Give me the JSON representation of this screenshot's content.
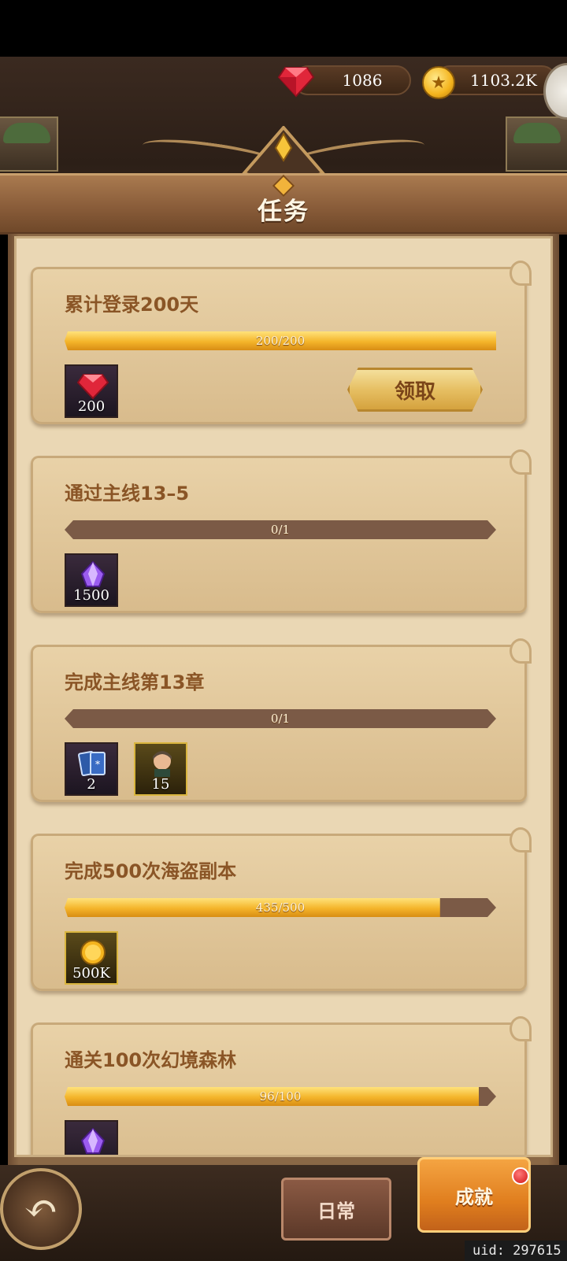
{
  "resources": {
    "gems": "1086",
    "coins": "1103.2K"
  },
  "header": {
    "title": "任务"
  },
  "quests": [
    {
      "title": "累计登录200天",
      "progress_text": "200/200",
      "progress": 1.0,
      "rewards": [
        {
          "icon": "ruby-gem-icon",
          "qty": "200"
        }
      ],
      "claim_label": "领取"
    },
    {
      "title": "通过主线13–5",
      "progress_text": "0/1",
      "progress": 0.0,
      "rewards": [
        {
          "icon": "purple-crystal-icon",
          "qty": "1500"
        }
      ]
    },
    {
      "title": "完成主线第13章",
      "progress_text": "0/1",
      "progress": 0.0,
      "rewards": [
        {
          "icon": "card-pack-icon",
          "qty": "2"
        },
        {
          "icon": "hero-portrait-icon",
          "qty": "15"
        }
      ]
    },
    {
      "title": "完成500次海盗副本",
      "progress_text": "435/500",
      "progress": 0.87,
      "rewards": [
        {
          "icon": "gold-coin-icon",
          "qty": "500K"
        }
      ]
    },
    {
      "title": "通关100次幻境森林",
      "progress_text": "96/100",
      "progress": 0.96,
      "rewards": [
        {
          "icon": "purple-crystal-icon",
          "qty": ""
        }
      ]
    }
  ],
  "tabs": {
    "daily": "日常",
    "achievement": "成就"
  },
  "footer": {
    "uid": "uid: 297615"
  },
  "colors": {
    "accent": "#f4b42a",
    "panel": "#ead7b4",
    "title_text": "#8a5526"
  }
}
